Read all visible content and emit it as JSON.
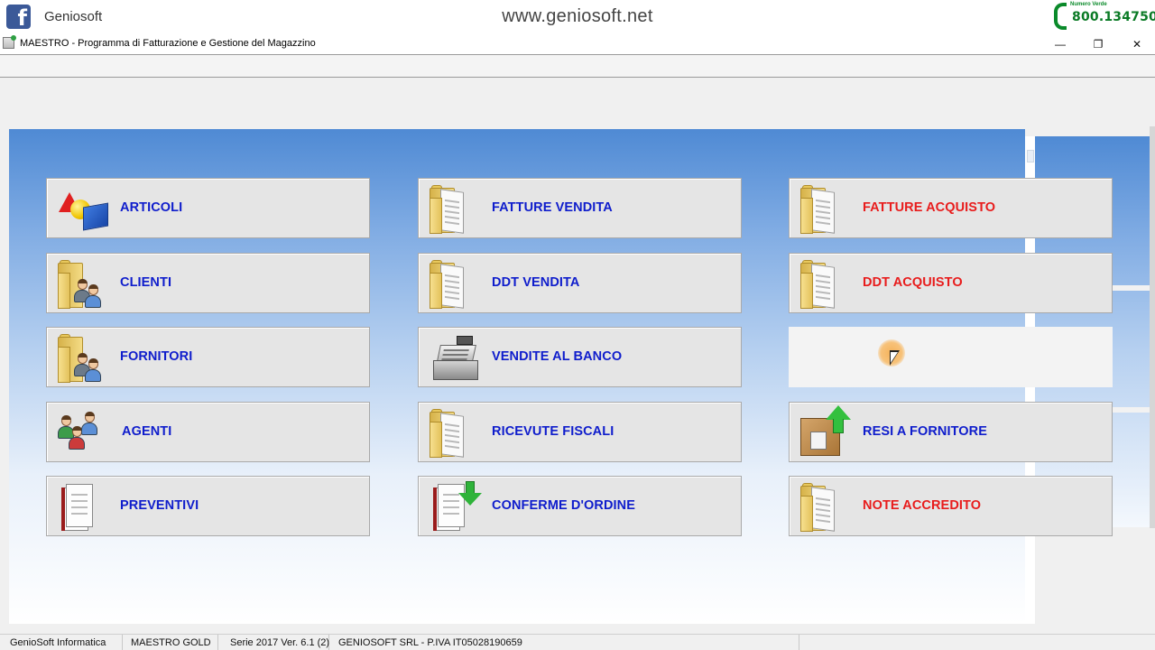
{
  "branding": {
    "facebook_glyph": "f",
    "name": "Geniosoft",
    "website": "www.geniosoft.net",
    "phone_caption": "Numero Verde",
    "phone_number": "800.134750"
  },
  "window": {
    "title": "MAESTRO - Programma di Fatturazione e Gestione del Magazzino",
    "minimize_glyph": "—",
    "maximize_glyph": "❐",
    "close_glyph": "✕"
  },
  "menu": {
    "articoli": "ARTICOLI",
    "clienti": "CLIENTI",
    "fornitori": "FORNITORI",
    "agenti": "AGENTI",
    "preventivi": "PREVENTIVI",
    "fatture_vendita": "FATTURE VENDITA",
    "ddt_vendita": "DDT VENDITA",
    "vendite_al_banco": "VENDITE AL BANCO",
    "ricevute_fiscali": "RICEVUTE FISCALI",
    "conferme_ordine": "CONFERME D'ORDINE",
    "fatture_acquisto": "FATTURE ACQUISTO",
    "ddt_acquisto": "DDT ACQUISTO",
    "resi_fornitore": "RESI A FORNITORE",
    "note_accredito": "NOTE ACCREDITO"
  },
  "icons": {
    "articoli": "shapes-icon",
    "folder": "folder-icon",
    "people": "people-folder-icon",
    "agents": "agents-icon",
    "register": "cash-register-icon",
    "document": "document-icon",
    "document_download": "document-arrow-down-icon",
    "box_return": "box-arrow-up-icon"
  },
  "colors": {
    "label_blue": "#0f1dcc",
    "label_red": "#e81c1c",
    "panel_top": "#4f8ad4",
    "button_face": "#e5e5e5"
  },
  "statusbar": {
    "company": "GenioSoft Informatica",
    "edition": "MAESTRO GOLD",
    "version": "Serie 2017 Ver. 6.1 (2)",
    "license": "GENIOSOFT SRL  - P.IVA IT05028190659"
  }
}
